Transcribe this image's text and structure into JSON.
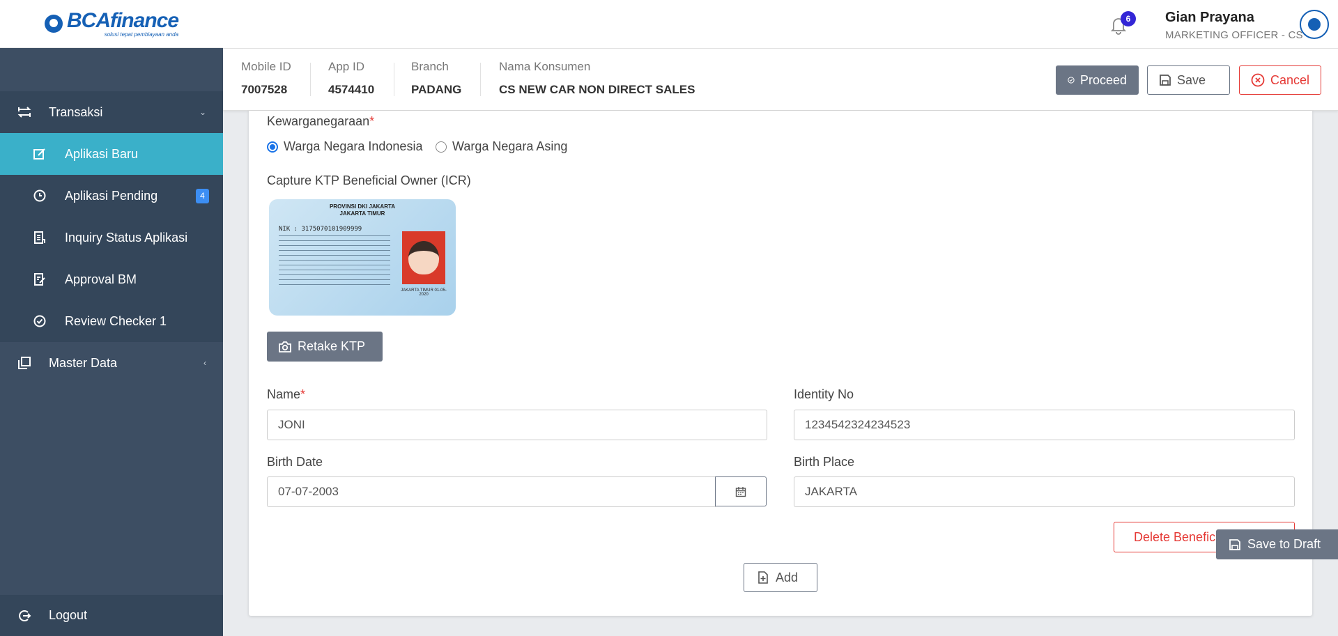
{
  "brand": {
    "name": "BCAfinance",
    "tagline": "solusi tepat pembiayaan anda",
    "color": "#1560b5"
  },
  "sidebar": {
    "groups": [
      {
        "label": "Transaksi",
        "icon": "swap-arrows-icon",
        "expanded": true
      },
      {
        "label": "Master Data",
        "icon": "copy-icon",
        "expanded": false
      }
    ],
    "items": [
      {
        "label": "Aplikasi Baru",
        "icon": "edit-box-icon",
        "active": true
      },
      {
        "label": "Aplikasi Pending",
        "icon": "clock-icon",
        "badge": "4"
      },
      {
        "label": "Inquiry Status Aplikasi",
        "icon": "document-list-icon"
      },
      {
        "label": "Approval BM",
        "icon": "document-edit-icon"
      },
      {
        "label": "Review Checker 1",
        "icon": "check-circle-icon"
      }
    ],
    "logout_label": "Logout"
  },
  "header": {
    "notification_count": "6",
    "user_name": "Gian Prayana",
    "user_role": "MARKETING OFFICER - CS"
  },
  "app_info": {
    "mobile_id_label": "Mobile ID",
    "mobile_id": "7007528",
    "app_id_label": "App ID",
    "app_id": "4574410",
    "branch_label": "Branch",
    "branch": "PADANG",
    "nama_konsumen_label": "Nama Konsumen",
    "nama_konsumen": "CS NEW CAR NON DIRECT SALES"
  },
  "actions": {
    "proceed": "Proceed",
    "save": "Save",
    "cancel": "Cancel"
  },
  "form": {
    "kewarganegaraan_label": "Kewarganegaraan",
    "radio_indonesia": "Warga Negara Indonesia",
    "radio_asing": "Warga Negara Asing",
    "selected_citizenship": "Warga Negara Indonesia",
    "capture_label": "Capture KTP Beneficial Owner (ICR)",
    "ktp_card": {
      "province": "PROVINSI DKI JAKARTA",
      "city": "JAKARTA TIMUR",
      "nik": "NIK : 3175070101909999",
      "issued": "JAKARTA TIMUR 01-05-2020"
    },
    "retake_label": "Retake KTP",
    "name_label": "Name",
    "name_value": "JONI",
    "identity_label": "Identity No",
    "identity_value": "1234542324234523",
    "birth_date_label": "Birth Date",
    "birth_date_value": "07-07-2003",
    "birth_place_label": "Birth Place",
    "birth_place_value": "JAKARTA",
    "delete_label": "Delete Benefici",
    "add_label": "Add"
  },
  "save_to_draft": "Save to Draft"
}
